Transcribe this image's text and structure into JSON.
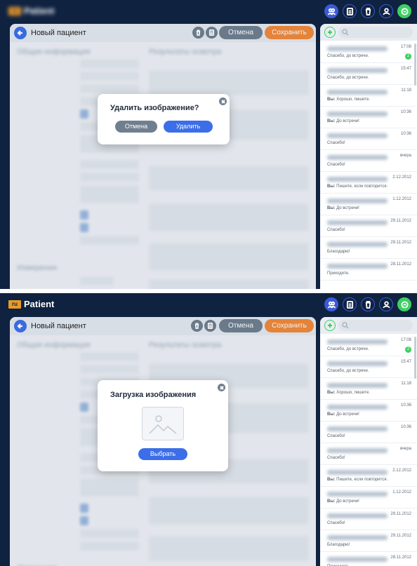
{
  "app": {
    "flag_label": "ru",
    "name": "Patient"
  },
  "header": {
    "title": "Новый пациент",
    "cancel_label": "Отмена",
    "save_label": "Сохранить"
  },
  "form": {
    "general_title": "Общая информация",
    "results_title": "Результаты осмотра",
    "measurements_title": "Измерения"
  },
  "dialog_delete": {
    "title": "Удалить изображение?",
    "cancel_label": "Отмена",
    "confirm_label": "Удалить"
  },
  "dialog_upload": {
    "title": "Загрузка изображения",
    "choose_label": "Выбрать"
  },
  "conversations_top": [
    {
      "time": "17:08",
      "message": "Спасибо, до встречи.",
      "badge": "2"
    },
    {
      "time": "15:47",
      "message": "Спасибо, до встречи."
    },
    {
      "time": "11:18",
      "prefix": "Вы:",
      "message": "Хорошо, пишите."
    },
    {
      "time": "10:36",
      "prefix": "Вы:",
      "message": "До встречи!"
    },
    {
      "time": "10:36",
      "message": "Спасибо!"
    },
    {
      "time": "вчера",
      "message": "Спасибо!"
    },
    {
      "time": "2.12.2012",
      "prefix": "Вы:",
      "message": "Пишите, если повторится."
    },
    {
      "time": "1.12.2012",
      "prefix": "Вы:",
      "message": "До встречи!"
    },
    {
      "time": "29.11.2012",
      "message": "Спасибо!"
    },
    {
      "time": "29.11.2012",
      "message": "Благодарю!"
    },
    {
      "time": "28.11.2012",
      "message": "Приходите."
    }
  ],
  "conversations_bottom": [
    {
      "time": "17:08",
      "message": "Спасибо, до встречи.",
      "badge": "2"
    },
    {
      "time": "15:47",
      "message": "Спасибо, до встречи."
    },
    {
      "time": "11:18",
      "prefix": "Вы:",
      "message": "Хорошо, пишите."
    },
    {
      "time": "10:36",
      "prefix": "Вы:",
      "message": "До встречи!"
    },
    {
      "time": "10:36",
      "message": "Спасибо!"
    },
    {
      "time": "вчера",
      "message": "Спасибо!"
    },
    {
      "time": "2.12.2012",
      "prefix": "Вы:",
      "message": "Пишите, если повторится."
    },
    {
      "time": "1.12.2012",
      "prefix": "Вы:",
      "message": "До встречи!"
    },
    {
      "time": "29.11.2012",
      "message": "Спасибо!"
    },
    {
      "time": "29.11.2012",
      "message": "Благодарю!"
    },
    {
      "time": "28.11.2012",
      "message": "Приходите."
    }
  ],
  "colors": {
    "background": "#0f2240",
    "accent": "#3b6ee8",
    "save": "#f0883a",
    "online": "#3ecf62"
  }
}
